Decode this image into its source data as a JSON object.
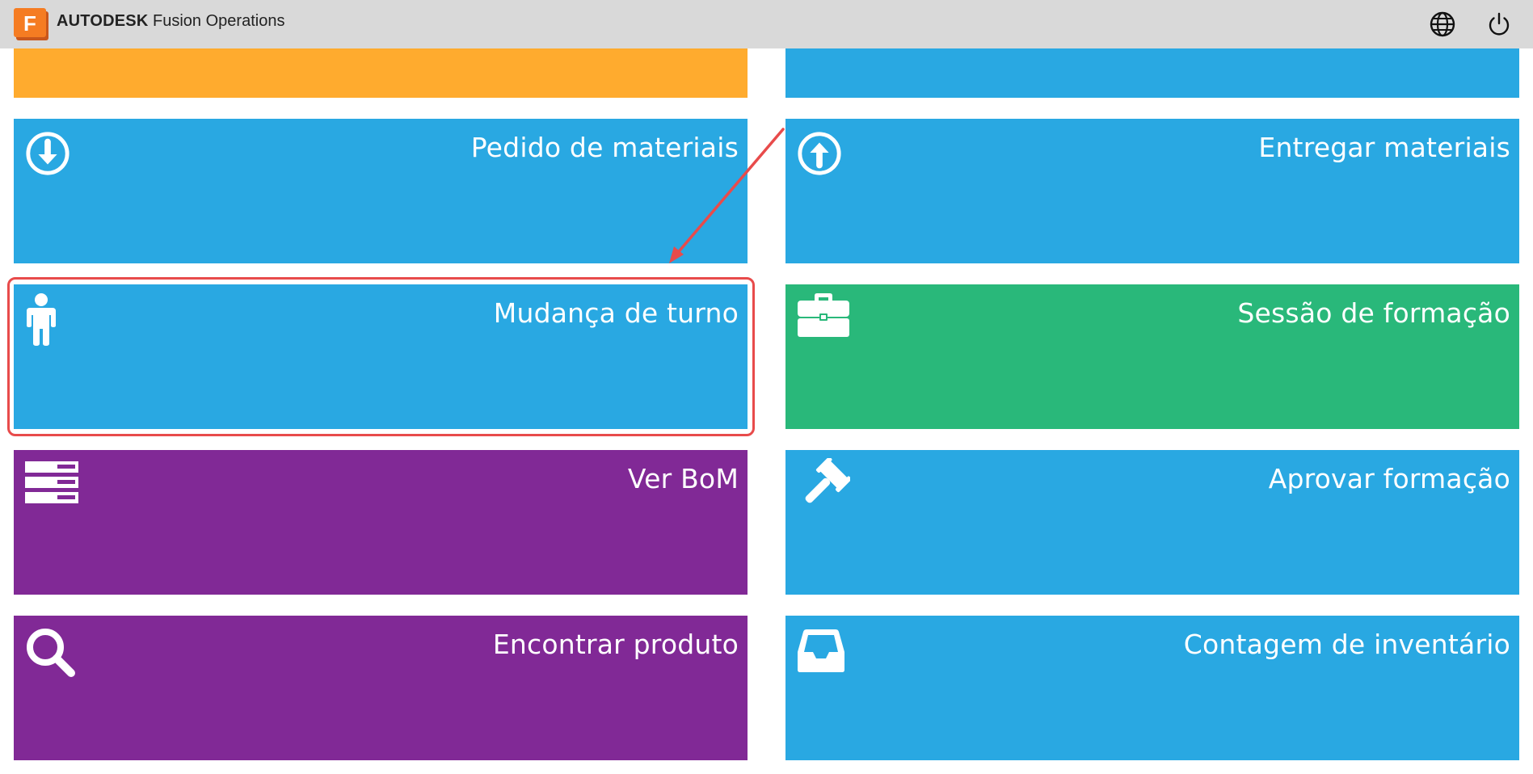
{
  "header": {
    "logo_letter": "F",
    "brand_strong": "AUTODESK",
    "brand_rest": " Fusion Operations",
    "icons": [
      "globe-icon",
      "power-icon"
    ]
  },
  "tiles": [
    {
      "label": "",
      "color": "#ffab2e",
      "icon": ""
    },
    {
      "label": "",
      "color": "#29a8e2",
      "icon": ""
    },
    {
      "label": "Pedido de materiais",
      "color": "#29a8e2",
      "icon": "arrow-down-circle-icon"
    },
    {
      "label": "Entregar materiais",
      "color": "#29a8e2",
      "icon": "arrow-up-circle-icon"
    },
    {
      "label": "Mudança de turno",
      "color": "#29a8e2",
      "icon": "person-icon"
    },
    {
      "label": "Sessão de formação",
      "color": "#29b87a",
      "icon": "briefcase-icon"
    },
    {
      "label": "Ver BoM",
      "color": "#812996",
      "icon": "server-icon"
    },
    {
      "label": "Aprovar formação",
      "color": "#29a8e2",
      "icon": "gavel-icon"
    },
    {
      "label": "Encontrar produto",
      "color": "#812996",
      "icon": "search-icon"
    },
    {
      "label": "Contagem de inventário",
      "color": "#29a8e2",
      "icon": "inbox-icon"
    }
  ],
  "annotation": {
    "highlight_color": "#e84b4b",
    "highlighted_tile": "Mudança de turno"
  }
}
